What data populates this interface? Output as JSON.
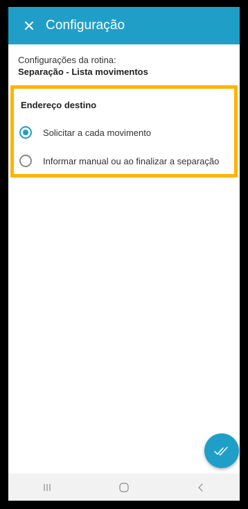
{
  "appbar": {
    "title": "Configuração",
    "close_icon": "close-icon"
  },
  "routine": {
    "label": "Configurações da rotina:",
    "name": "Separação - Lista movimentos"
  },
  "destination_section": {
    "title": "Endereço destino",
    "accent_color": "#ffb300",
    "options": [
      {
        "label": "Solicitar a cada movimento",
        "selected": true
      },
      {
        "label": "Informar manual ou ao finalizar a separação",
        "selected": false
      }
    ]
  },
  "fab": {
    "icon": "double-check-icon",
    "color": "#1f9fc7"
  },
  "navbar": {
    "recent_icon": "recent-apps-icon",
    "home_icon": "home-icon",
    "back_icon": "back-icon"
  },
  "colors": {
    "primary": "#1f9fc7",
    "highlight": "#ffb300"
  }
}
